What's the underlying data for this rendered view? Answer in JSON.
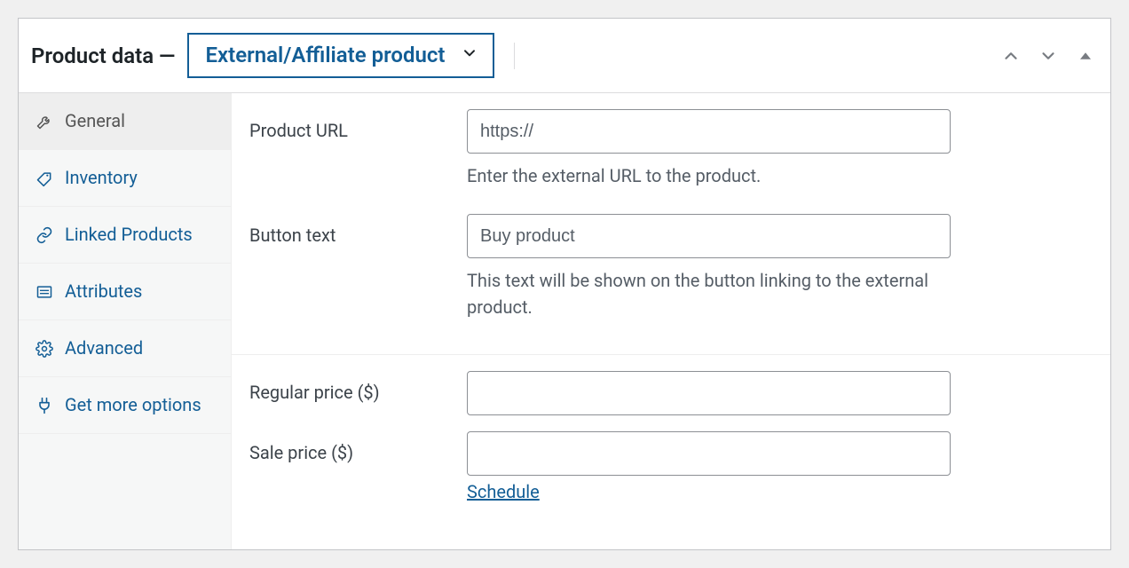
{
  "header": {
    "title_prefix": "Product data",
    "dash": " — ",
    "product_type": "External/Affiliate product"
  },
  "sidebar": {
    "items": [
      {
        "key": "general",
        "label": "General",
        "active": true
      },
      {
        "key": "inventory",
        "label": "Inventory",
        "active": false
      },
      {
        "key": "linked",
        "label": "Linked Products",
        "active": false
      },
      {
        "key": "attributes",
        "label": "Attributes",
        "active": false
      },
      {
        "key": "advanced",
        "label": "Advanced",
        "active": false
      },
      {
        "key": "more",
        "label": "Get more options",
        "active": false
      }
    ]
  },
  "form": {
    "product_url": {
      "label": "Product URL",
      "value": "",
      "placeholder": "https://",
      "help": "Enter the external URL to the product."
    },
    "button_text": {
      "label": "Button text",
      "value": "",
      "placeholder": "Buy product",
      "help": "This text will be shown on the button linking to the external product."
    },
    "regular_price": {
      "label": "Regular price ($)",
      "value": ""
    },
    "sale_price": {
      "label": "Sale price ($)",
      "value": "",
      "schedule_link": "Schedule"
    }
  }
}
